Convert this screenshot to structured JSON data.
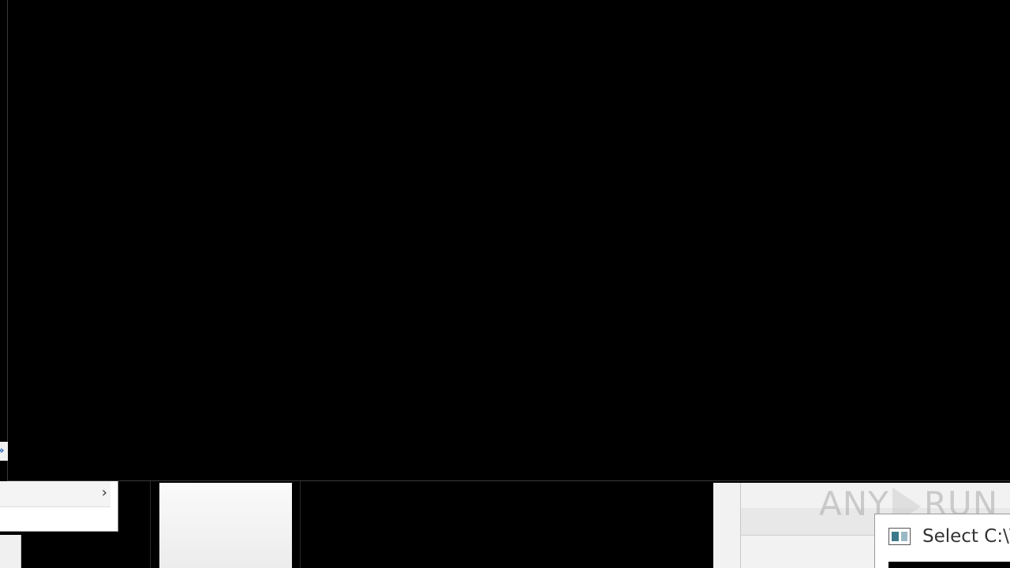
{
  "screen": {
    "background": "#000000"
  },
  "left_panel": {
    "chevron_icon": "chevron-right-icon",
    "chevron_glyph": "›",
    "tab_icon": "network-icon"
  },
  "watermark": {
    "left_text": "ANY",
    "right_text": "RUN"
  },
  "select_window": {
    "title": "Select C:\\V",
    "icon": "console-window-icon"
  }
}
